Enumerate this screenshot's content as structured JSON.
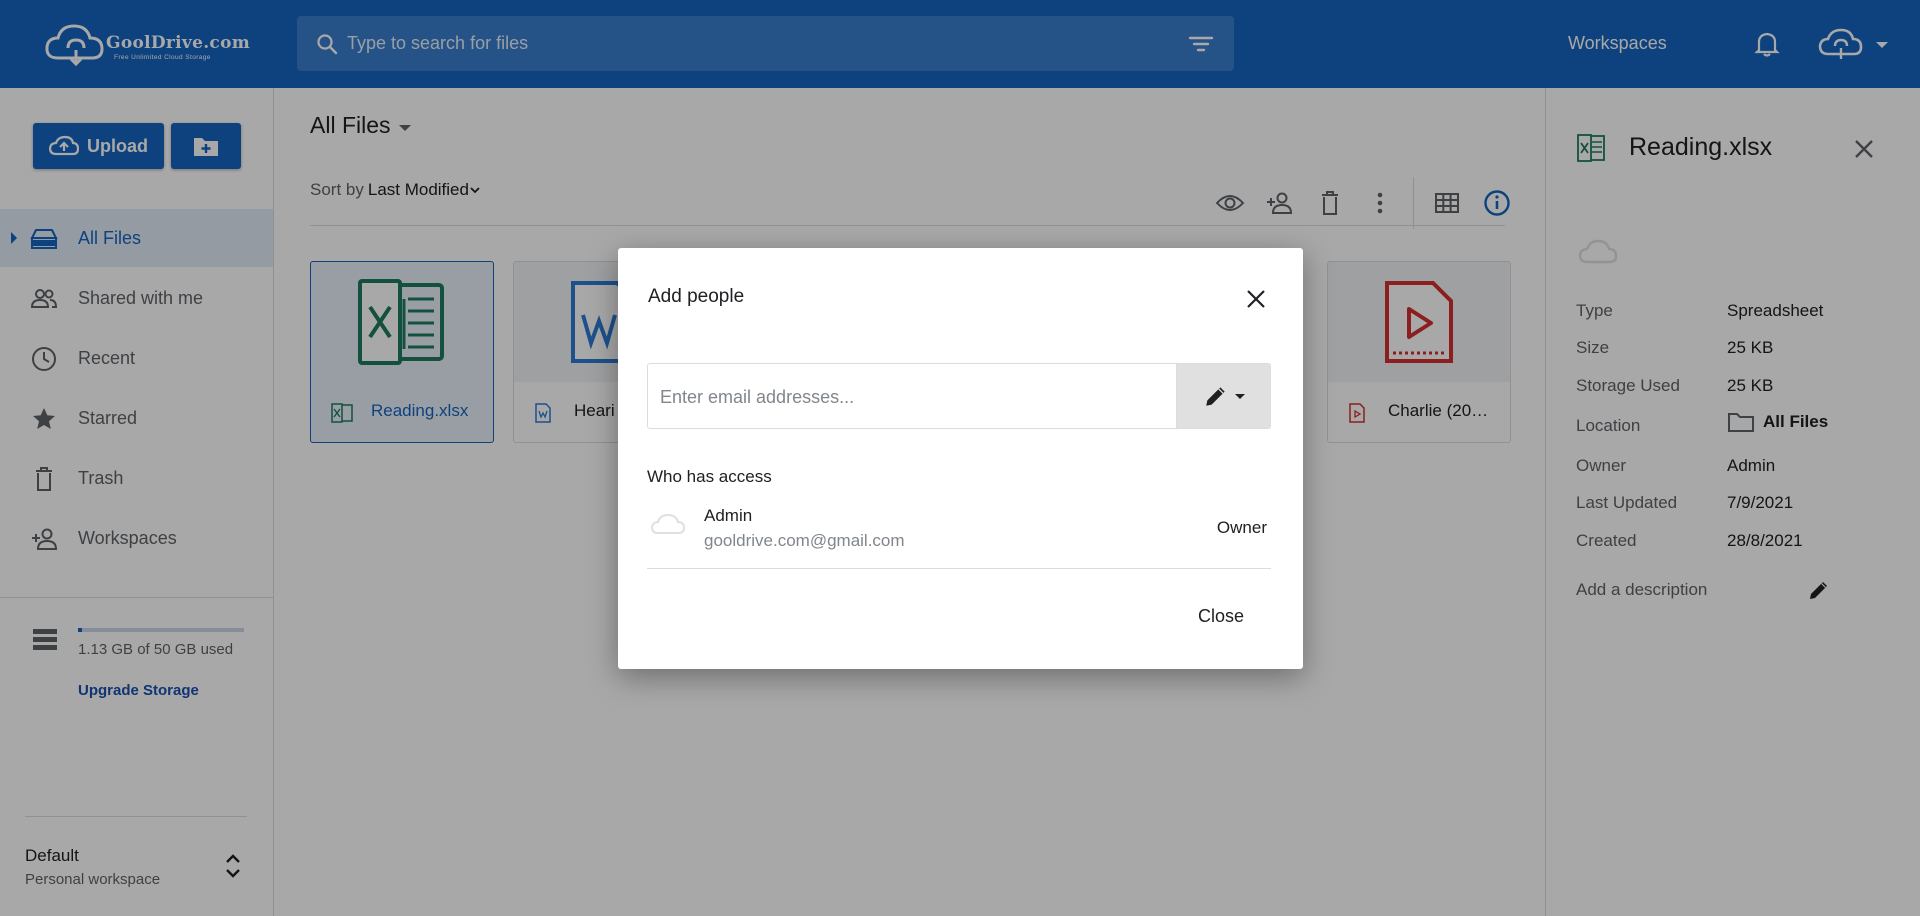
{
  "header": {
    "brand": "GoolDrive.com",
    "tagline": "Free Unlimited Cloud Storage",
    "search_placeholder": "Type to search for files",
    "workspaces_link": "Workspaces",
    "colors": {
      "primary": "#1565c0"
    }
  },
  "sidebar": {
    "upload_label": "Upload",
    "nav": [
      {
        "label": "All Files",
        "icon": "storage-icon",
        "active": true
      },
      {
        "label": "Shared with me",
        "icon": "people-icon"
      },
      {
        "label": "Recent",
        "icon": "clock-icon"
      },
      {
        "label": "Starred",
        "icon": "star-icon"
      },
      {
        "label": "Trash",
        "icon": "trash-icon"
      },
      {
        "label": "Workspaces",
        "icon": "person-add-icon"
      }
    ],
    "storage": {
      "text": "1.13 GB of 50 GB used",
      "used_fraction": 0.0226,
      "upgrade": "Upgrade Storage"
    },
    "workspace": {
      "name": "Default",
      "sub": "Personal workspace"
    }
  },
  "main": {
    "breadcrumb": "All Files",
    "sort_prefix": "Sort by",
    "sort_value": "Last Modified",
    "files": [
      {
        "name": "Reading.xlsx",
        "type": "spreadsheet",
        "color": "#1e7b5f",
        "selected": true
      },
      {
        "name": "Heari",
        "type": "word",
        "color": "#2b7cd3"
      },
      {
        "name": "Charlie (20…",
        "type": "video",
        "color": "#d32f2f"
      }
    ]
  },
  "details": {
    "title": "Reading.xlsx",
    "rows": [
      {
        "key": "Type",
        "value": "Spreadsheet"
      },
      {
        "key": "Size",
        "value": "25 KB"
      },
      {
        "key": "Storage Used",
        "value": "25 KB"
      },
      {
        "key": "Location",
        "value": "All Files"
      },
      {
        "key": "Owner",
        "value": "Admin"
      },
      {
        "key": "Last Updated",
        "value": "7/9/2021"
      },
      {
        "key": "Created",
        "value": "28/8/2021"
      }
    ],
    "description_placeholder": "Add a description"
  },
  "dialog": {
    "title": "Add people",
    "email_placeholder": "Enter email addresses...",
    "who_has_access": "Who has access",
    "person": {
      "name": "Admin",
      "email": "gooldrive.com@gmail.com",
      "role": "Owner"
    },
    "close_label": "Close"
  }
}
